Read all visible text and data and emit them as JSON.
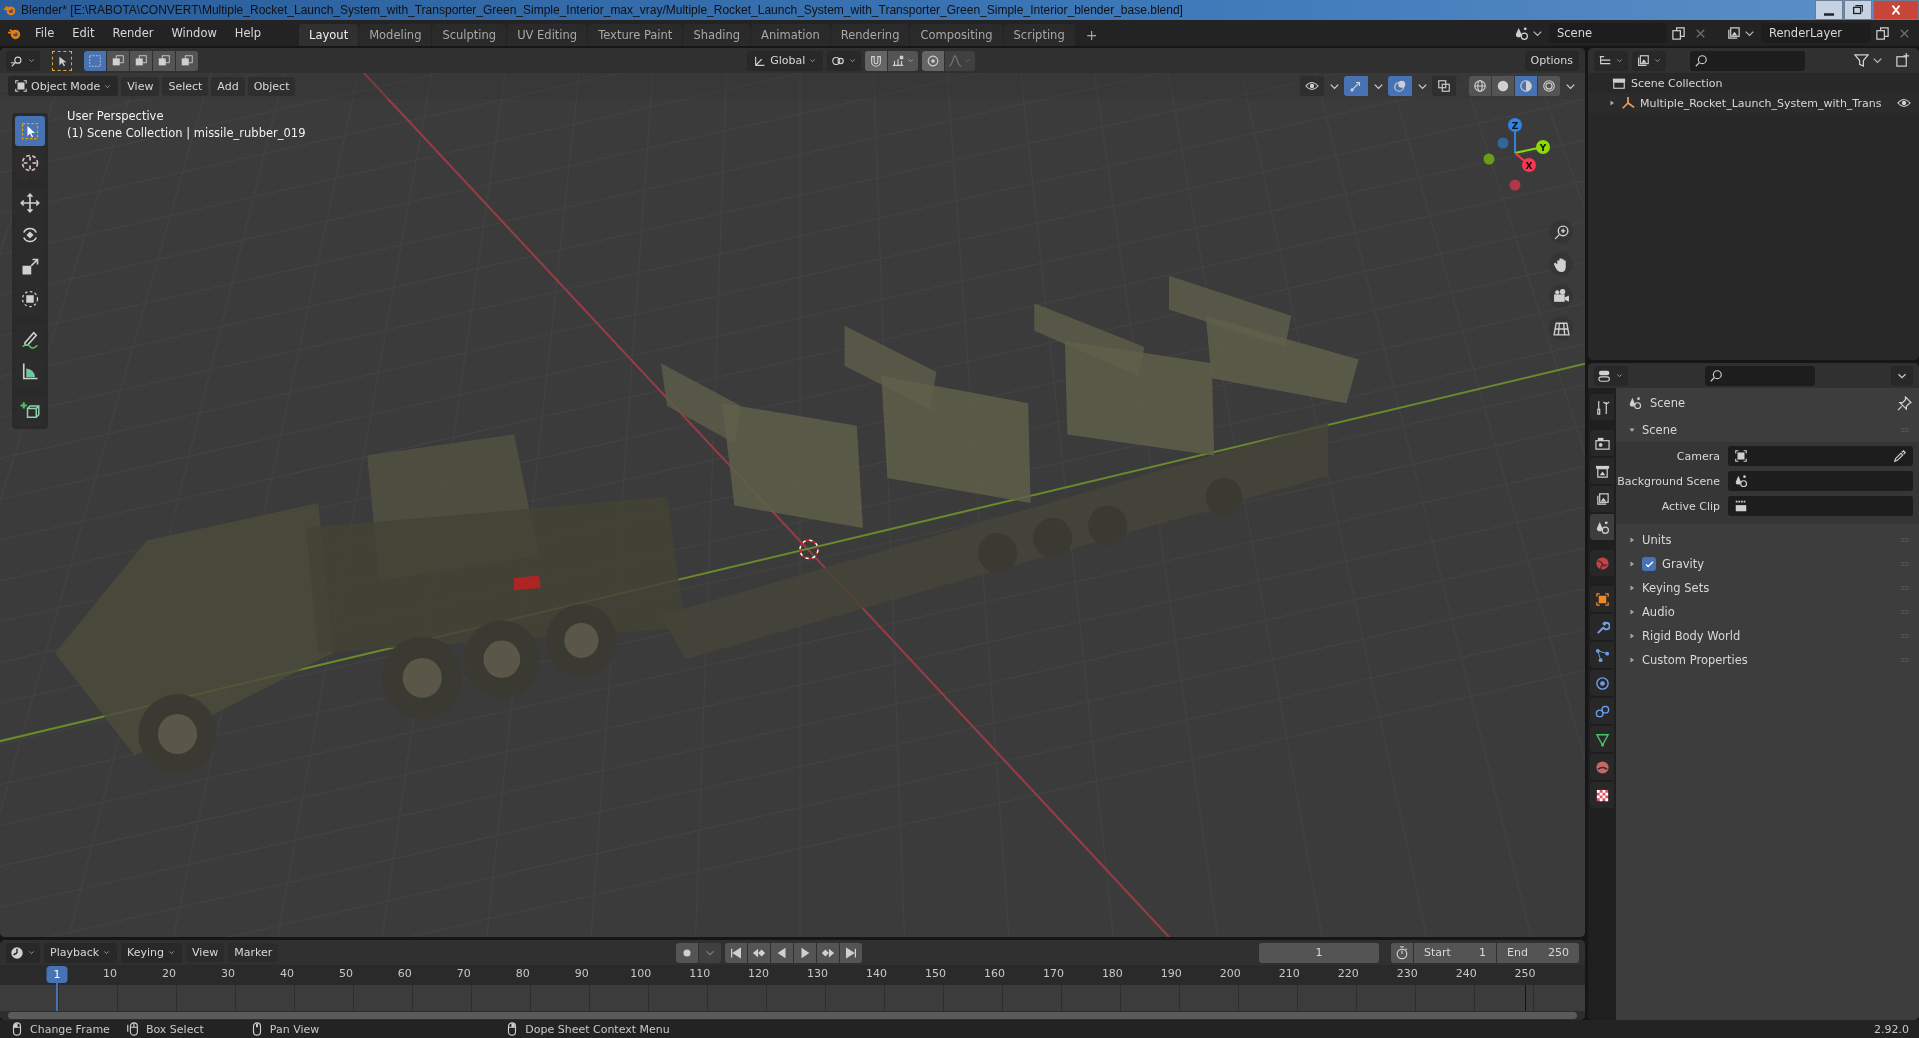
{
  "window": {
    "title": "Blender* [E:\\RABOTA\\CONVERT\\Multiple_Rocket_Launch_System_with_Transporter_Green_Simple_Interior_max_vray/Multiple_Rocket_Launch_System_with_Transporter_Green_Simple_Interior_blender_base.blend]"
  },
  "menu": [
    "File",
    "Edit",
    "Render",
    "Window",
    "Help"
  ],
  "workspaces": [
    {
      "label": "Layout",
      "selected": true
    },
    {
      "label": "Modeling",
      "selected": false
    },
    {
      "label": "Sculpting",
      "selected": false
    },
    {
      "label": "UV Editing",
      "selected": false
    },
    {
      "label": "Texture Paint",
      "selected": false
    },
    {
      "label": "Shading",
      "selected": false
    },
    {
      "label": "Animation",
      "selected": false
    },
    {
      "label": "Rendering",
      "selected": false
    },
    {
      "label": "Compositing",
      "selected": false
    },
    {
      "label": "Scripting",
      "selected": false
    }
  ],
  "add_workspace": "+",
  "scene_selector": {
    "value": "Scene"
  },
  "view_layer_selector": {
    "value": "RenderLayer"
  },
  "viewport": {
    "select_modes": [
      {
        "selected": true
      },
      {
        "selected": false
      },
      {
        "selected": false
      },
      {
        "selected": false
      },
      {
        "selected": false
      }
    ],
    "transform_orientation": "Global",
    "options": "Options",
    "mode": "Object Mode",
    "menus": [
      "View",
      "Select",
      "Add",
      "Object"
    ],
    "toggles": [
      {
        "kind": "visibility",
        "on": false
      },
      {
        "kind": "gizmo",
        "on": true
      },
      {
        "kind": "overlay",
        "on": true
      },
      {
        "kind": "xray",
        "on": false
      }
    ],
    "shading": [
      {
        "kind": "wireframe",
        "selected": false
      },
      {
        "kind": "solid",
        "selected": false
      },
      {
        "kind": "material",
        "selected": true
      },
      {
        "kind": "rendered",
        "selected": false
      }
    ],
    "overlay_text": [
      "User Perspective",
      "(1) Scene Collection | missile_rubber_019"
    ],
    "tools": [
      {
        "kind": "select",
        "selected": true
      },
      {
        "kind": "cursor",
        "selected": false
      },
      {
        "kind": "move",
        "selected": false
      },
      {
        "kind": "rotate",
        "selected": false
      },
      {
        "kind": "scale",
        "selected": false
      },
      {
        "kind": "transform",
        "selected": false
      },
      {
        "kind": "annotate",
        "selected": false
      },
      {
        "kind": "measure",
        "selected": false
      },
      {
        "kind": "add_cube",
        "selected": false
      }
    ],
    "gizmo_axes": [
      {
        "label": "Z",
        "color": "#2f83e3"
      },
      {
        "label": "Y",
        "color": "#8bdc00"
      },
      {
        "label": "X",
        "color": "#ff3352"
      }
    ]
  },
  "outliner": {
    "root": "Scene Collection",
    "children": [
      {
        "label": "Multiple_Rocket_Launch_System_with_Trans",
        "expanded": false,
        "visible": true
      }
    ]
  },
  "properties": {
    "tabs": [
      {
        "kind": "tool",
        "selected": false
      },
      {
        "kind": "render",
        "selected": false
      },
      {
        "kind": "output",
        "selected": false
      },
      {
        "kind": "view_layer",
        "selected": false
      },
      {
        "kind": "scene",
        "selected": true
      },
      {
        "kind": "world",
        "selected": false
      },
      {
        "kind": "object",
        "selected": false
      },
      {
        "kind": "modifiers",
        "selected": false
      },
      {
        "kind": "particles",
        "selected": false
      },
      {
        "kind": "physics",
        "selected": false
      },
      {
        "kind": "constraints",
        "selected": false
      },
      {
        "kind": "data",
        "selected": false
      },
      {
        "kind": "material",
        "selected": false
      },
      {
        "kind": "texture",
        "selected": false
      }
    ],
    "context": "Scene",
    "panels": [
      {
        "title": "Scene",
        "expanded": true,
        "fields": [
          {
            "label": "Camera",
            "kind": "camera"
          },
          {
            "label": "Background Scene",
            "kind": "scene"
          },
          {
            "label": "Active Clip",
            "kind": "clip"
          }
        ]
      },
      {
        "title": "Units",
        "expanded": false
      },
      {
        "title": "Gravity",
        "expanded": false,
        "checked": true
      },
      {
        "title": "Keying Sets",
        "expanded": false
      },
      {
        "title": "Audio",
        "expanded": false
      },
      {
        "title": "Rigid Body World",
        "expanded": false
      },
      {
        "title": "Custom Properties",
        "expanded": false
      }
    ]
  },
  "timeline": {
    "menus": [
      {
        "label": "Playback",
        "kind": "dropdown"
      },
      {
        "label": "Keying",
        "kind": "dropdown"
      },
      {
        "label": "View",
        "kind": "menu"
      },
      {
        "label": "Marker",
        "kind": "menu"
      }
    ],
    "current_frame": "1",
    "start_label": "Start",
    "start": "1",
    "end_label": "End",
    "end": "250",
    "ruler": [
      {
        "label": "1",
        "selected": true
      },
      {
        "label": "10",
        "selected": false
      },
      {
        "label": "20",
        "selected": false
      },
      {
        "label": "30",
        "selected": false
      },
      {
        "label": "40",
        "selected": false
      },
      {
        "label": "50",
        "selected": false
      },
      {
        "label": "60",
        "selected": false
      },
      {
        "label": "70",
        "selected": false
      },
      {
        "label": "80",
        "selected": false
      },
      {
        "label": "90",
        "selected": false
      },
      {
        "label": "100",
        "selected": false
      },
      {
        "label": "110",
        "selected": false
      },
      {
        "label": "120",
        "selected": false
      },
      {
        "label": "130",
        "selected": false
      },
      {
        "label": "140",
        "selected": false
      },
      {
        "label": "150",
        "selected": false
      },
      {
        "label": "160",
        "selected": false
      },
      {
        "label": "170",
        "selected": false
      },
      {
        "label": "180",
        "selected": false
      },
      {
        "label": "190",
        "selected": false
      },
      {
        "label": "200",
        "selected": false
      },
      {
        "label": "210",
        "selected": false
      },
      {
        "label": "220",
        "selected": false
      },
      {
        "label": "230",
        "selected": false
      },
      {
        "label": "240",
        "selected": false
      },
      {
        "label": "250",
        "selected": false
      }
    ]
  },
  "status_bar": {
    "hints": [
      {
        "kind": "mouse_left",
        "label": "Change Frame"
      },
      {
        "kind": "mouse_drag",
        "label": "Box Select"
      },
      {
        "kind": "mouse_middle",
        "label": "Pan View"
      },
      {
        "kind": "mouse_right",
        "label": "Dope Sheet Context Menu"
      }
    ],
    "version": "2.92.0"
  }
}
